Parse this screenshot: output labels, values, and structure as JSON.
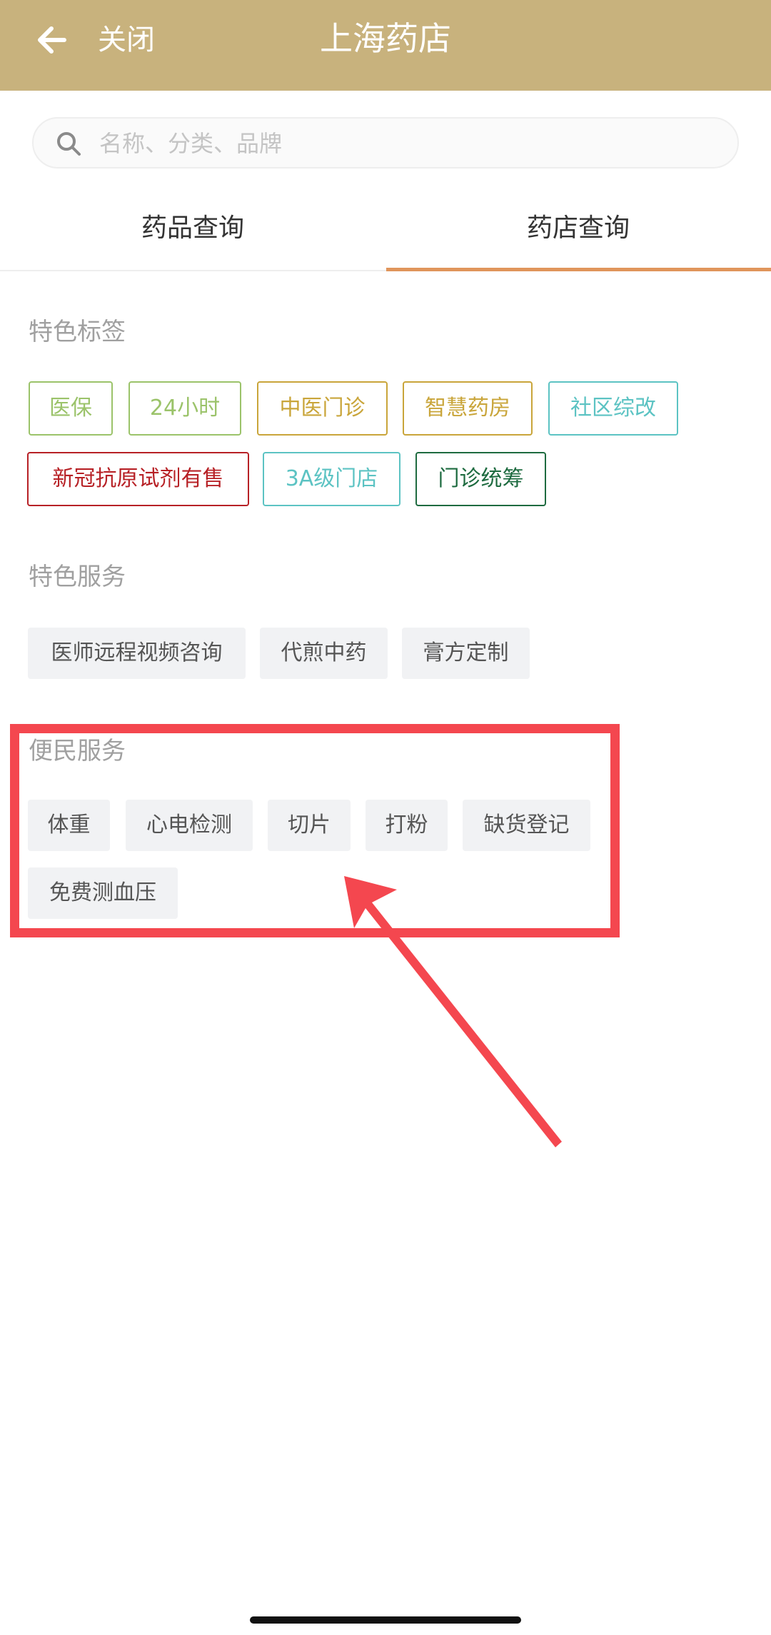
{
  "header": {
    "back_icon": "arrow-left-icon",
    "close_label": "关闭",
    "title": "上海药店",
    "background": "#c8b27d"
  },
  "search": {
    "placeholder": "名称、分类、品牌",
    "value": "",
    "icon": "search-icon"
  },
  "tabs": {
    "items": [
      {
        "label": "药品查询",
        "active": false
      },
      {
        "label": "药店查询",
        "active": true
      }
    ],
    "active_color": "#e0955b"
  },
  "feature_tags": {
    "title": "特色标签",
    "items": [
      {
        "label": "医保",
        "color": "#9bc36a"
      },
      {
        "label": "24小时",
        "color": "#9bc36a"
      },
      {
        "label": "中医门诊",
        "color": "#c9a53a"
      },
      {
        "label": "智慧药房",
        "color": "#c9a53a"
      },
      {
        "label": "社区综改",
        "color": "#5cc3c3"
      },
      {
        "label": "新冠抗原试剂有售",
        "color": "#b72126"
      },
      {
        "label": "3A级门店",
        "color": "#5cc3c3"
      },
      {
        "label": "门诊统筹",
        "color": "#1e6b40"
      }
    ]
  },
  "feature_services": {
    "title": "特色服务",
    "items": [
      {
        "label": "医师远程视频咨询"
      },
      {
        "label": "代煎中药"
      },
      {
        "label": "膏方定制"
      }
    ]
  },
  "convenience_services": {
    "title": "便民服务",
    "items": [
      {
        "label": "体重"
      },
      {
        "label": "心电检测"
      },
      {
        "label": "切片"
      },
      {
        "label": "打粉"
      },
      {
        "label": "缺货登记"
      },
      {
        "label": "免费测血压"
      }
    ]
  },
  "annotation": {
    "color": "#f4474f"
  }
}
